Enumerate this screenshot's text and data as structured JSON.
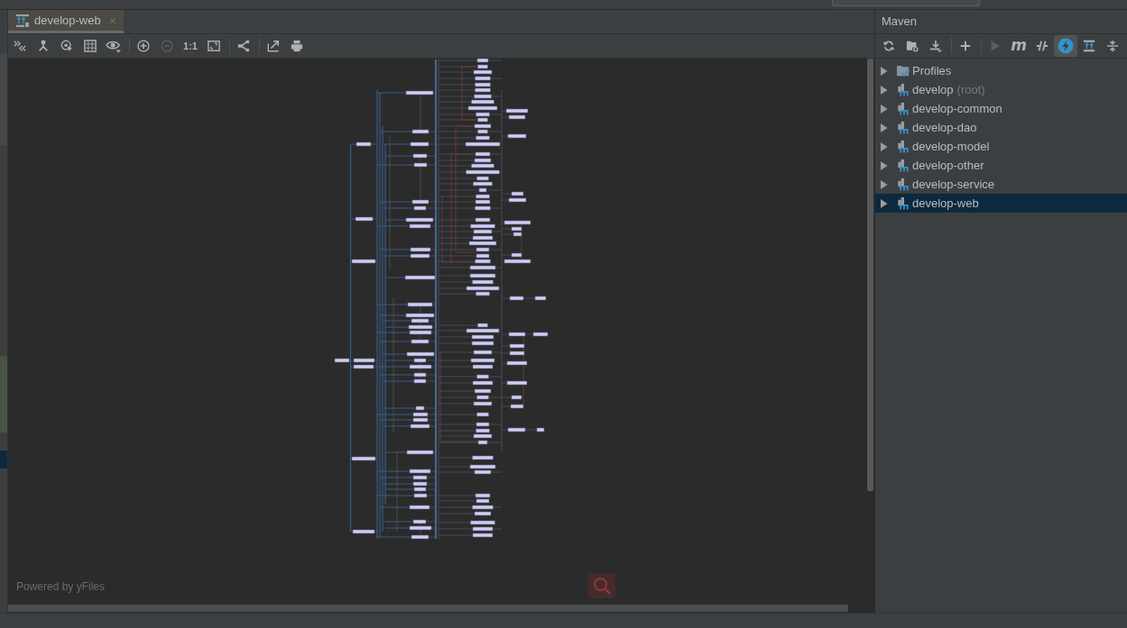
{
  "tabs": [
    {
      "title": "develop-web",
      "close": "×",
      "selected": true
    }
  ],
  "graph_toolbar": [
    [
      {
        "disabled": false
      },
      {
        "disabled": false
      },
      {
        "disabled": false
      },
      {
        "disabled": false
      },
      {
        "disabled": false
      }
    ],
    [
      {
        "disabled": false
      },
      {
        "disabled": true
      },
      {
        "label": "1:1",
        "disabled": false
      },
      {
        "disabled": false
      }
    ],
    [
      {
        "disabled": false
      }
    ],
    [
      {
        "disabled": false
      },
      {
        "disabled": false
      }
    ]
  ],
  "canvas": {
    "credit": "Powered by yFiles"
  },
  "maven": {
    "title": "Maven",
    "toolbar": [
      [
        {
          "disabled": false,
          "on": false
        },
        {
          "disabled": false,
          "on": false
        },
        {
          "disabled": false,
          "on": false
        }
      ],
      [
        {
          "disabled": false,
          "on": false
        }
      ],
      [
        {
          "disabled": true,
          "on": false
        },
        {
          "label": "m",
          "disabled": false,
          "on": false
        },
        {
          "disabled": false,
          "on": false
        },
        {
          "disabled": false,
          "on": true
        },
        {
          "disabled": false,
          "on": false
        },
        {
          "disabled": false,
          "on": false
        }
      ]
    ],
    "items": [
      {
        "kind": "profiles",
        "label": "Profiles",
        "expanded": false,
        "selected": false
      },
      {
        "kind": "module",
        "label": "develop",
        "suffix": "(root)",
        "expanded": false,
        "selected": false
      },
      {
        "kind": "module",
        "label": "develop-common",
        "expanded": false,
        "selected": false
      },
      {
        "kind": "module",
        "label": "develop-dao",
        "expanded": false,
        "selected": false
      },
      {
        "kind": "module",
        "label": "develop-model",
        "expanded": false,
        "selected": false
      },
      {
        "kind": "module",
        "label": "develop-other",
        "expanded": false,
        "selected": false
      },
      {
        "kind": "module",
        "label": "develop-service",
        "expanded": false,
        "selected": false
      },
      {
        "kind": "module",
        "label": "develop-web",
        "expanded": false,
        "selected": true
      }
    ]
  }
}
